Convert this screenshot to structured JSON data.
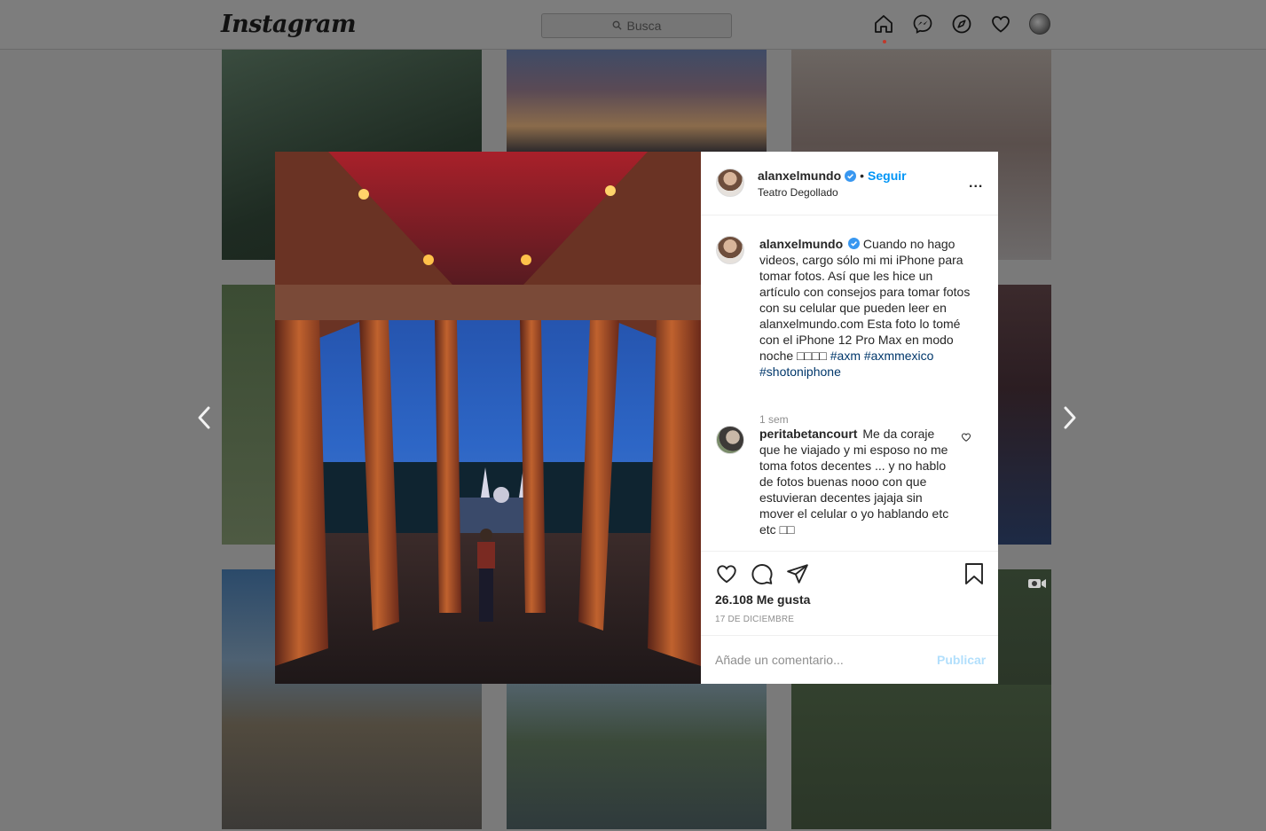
{
  "nav": {
    "logo": "Instagram",
    "search_placeholder": "Busca",
    "icons": [
      "home-icon",
      "messenger-icon",
      "explore-icon",
      "heart-icon",
      "profile-avatar"
    ]
  },
  "post": {
    "username": "alanxelmundo",
    "follow_label": "Seguir",
    "location": "Teatro Degollado",
    "more": "...",
    "caption": {
      "username": "alanxelmundo",
      "text": "Cuando no hago videos, cargo sólo mi mi iPhone para tomar fotos. Así que les hice un artículo con consejos para tomar fotos con su celular que pueden leer en alanxelmundo.com Esta foto lo tomé con el iPhone 12 Pro Max en modo noche □□□□",
      "tags": "#axm #axmmexico #shotoniphone",
      "time": "1 sem"
    },
    "comment": {
      "username": "peritabetancourt",
      "text": "Me da coraje que he viajado y mi esposo no me toma fotos decentes ... y no hablo de fotos buenas nooo con que estuvieran decentes jajaja sin mover el celular o yo hablando etc etc □□"
    },
    "likes": "26.108 Me gusta",
    "date": "17 DE DICIEMBRE",
    "comment_placeholder": "Añade un comentario...",
    "publish_label": "Publicar"
  },
  "colors": {
    "accent": "#0095f6",
    "hashtag": "#00376b",
    "publish_disabled": "#b2dffc",
    "overlay": "#7a7a7a"
  }
}
